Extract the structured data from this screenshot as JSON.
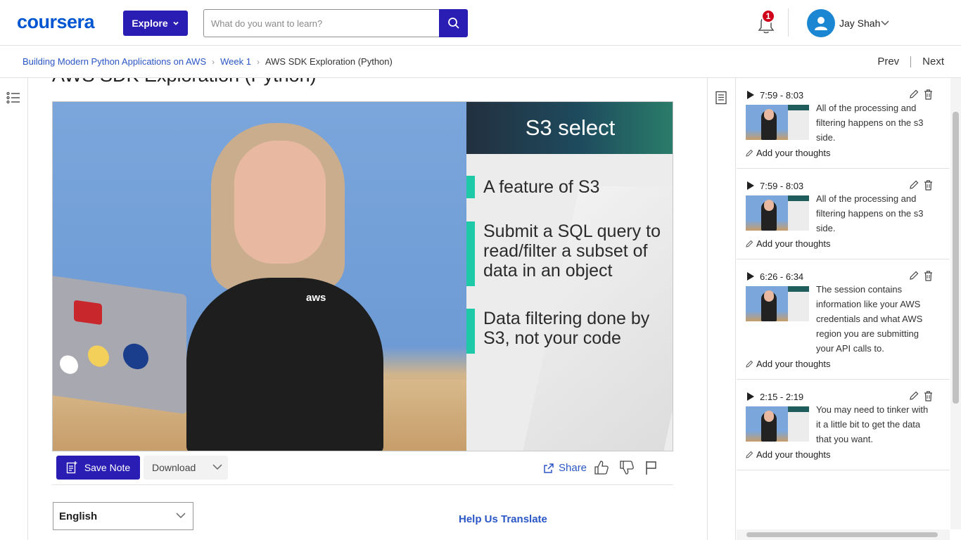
{
  "header": {
    "logo": "coursera",
    "explore_label": "Explore",
    "search_placeholder": "What do you want to learn?",
    "notification_count": "1",
    "user_name": "Jay Shah"
  },
  "breadcrumb": {
    "items": [
      "Building Modern Python Applications on AWS",
      "Week 1",
      "AWS SDK Exploration (Python)"
    ],
    "prev": "Prev",
    "next": "Next"
  },
  "main": {
    "title": "AWS SDK Exploration (Python)",
    "video": {
      "slide_title": "S3 select",
      "bullets": [
        "A feature of S3",
        "Submit a SQL query to read/filter a subset of data in an object",
        "Data filtering done by S3, not your code"
      ],
      "shirt_logo": "aws"
    },
    "actions": {
      "save_note": "Save Note",
      "download": "Download",
      "share": "Share"
    },
    "language": "English",
    "help_translate": "Help Us Translate"
  },
  "notes": [
    {
      "time": "7:59 - 8:03",
      "text": "All of the processing and filtering happens on the s3 side.",
      "add": "Add your thoughts"
    },
    {
      "time": "7:59 - 8:03",
      "text": "All of the processing and filtering happens on the s3 side.",
      "add": "Add your thoughts"
    },
    {
      "time": "6:26 - 6:34",
      "text": "The session contains information like your AWS credentials and what AWS region you are submitting your API calls to.",
      "add": "Add your thoughts"
    },
    {
      "time": "2:15 - 2:19",
      "text": "You may need to tinker with it a little bit to get the data that you want.",
      "add": "Add your thoughts"
    }
  ],
  "colors": {
    "brand": "#0056d2",
    "primary_button": "#2a1db3",
    "link": "#2a56c6",
    "badge": "#d0021b",
    "slide_accent": "#1ec9a8"
  }
}
